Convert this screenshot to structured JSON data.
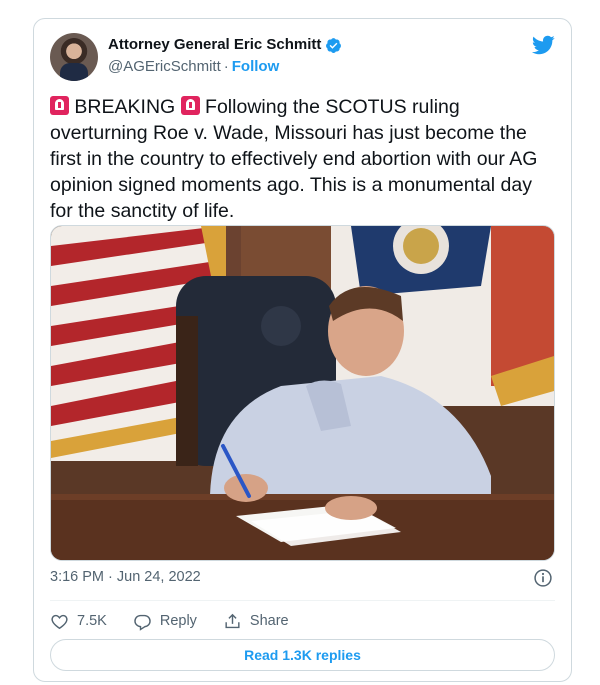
{
  "author": {
    "display_name": "Attorney General Eric Schmitt",
    "handle": "@AGEricSchmitt",
    "separator": "·",
    "follow_label": "Follow"
  },
  "tweet": {
    "lead": "BREAKING",
    "body": "Following the SCOTUS ruling overturning Roe v. Wade, Missouri has just become the first in the country to effectively end abortion with our AG opinion signed moments ago. This is a monumental day for the sanctity of life.",
    "timestamp": "3:16 PM · Jun 24, 2022"
  },
  "actions": {
    "likes": "7.5K",
    "reply_label": "Reply",
    "share_label": "Share"
  },
  "read_replies_label": "Read 1.3K replies",
  "icons": [
    "verified-badge-icon",
    "twitter-bird-icon",
    "siren-emoji-icon",
    "info-icon",
    "heart-icon",
    "reply-icon",
    "share-icon"
  ],
  "colors": {
    "accent": "#1d9bf0",
    "text": "#0f1419",
    "secondary": "#536471",
    "border": "#cfd9de",
    "siren": "#e0245e"
  }
}
